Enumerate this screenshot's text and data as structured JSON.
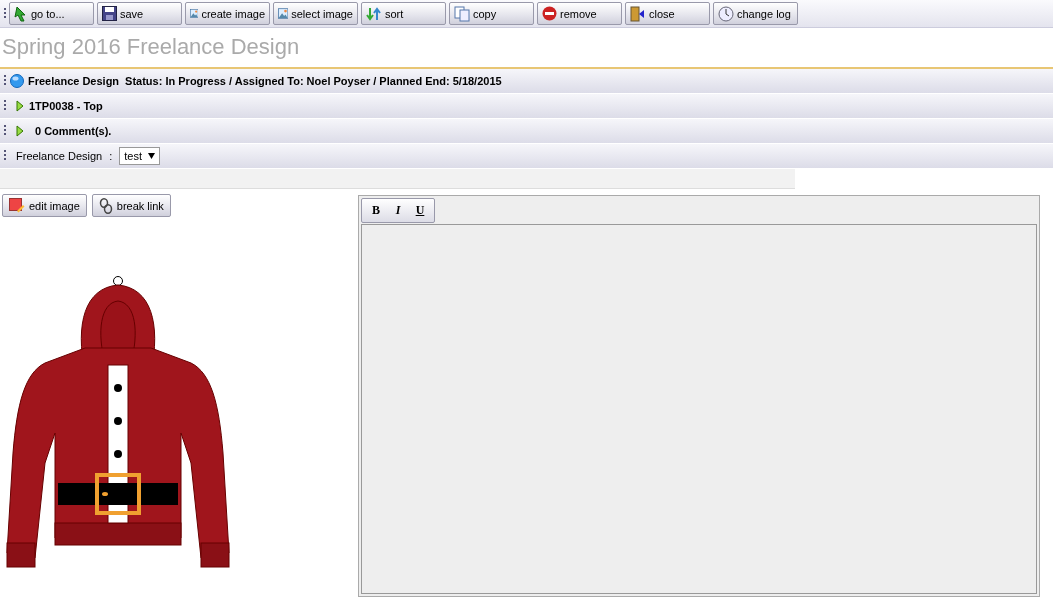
{
  "toolbar": [
    {
      "kind": "goto",
      "label": "go to..."
    },
    {
      "kind": "save",
      "label": "save"
    },
    {
      "kind": "image",
      "label": "create image"
    },
    {
      "kind": "image",
      "label": "select image"
    },
    {
      "kind": "sort",
      "label": "sort"
    },
    {
      "kind": "copy",
      "label": "copy"
    },
    {
      "kind": "remove",
      "label": "remove"
    },
    {
      "kind": "close",
      "label": "close"
    },
    {
      "kind": "log",
      "label": "change log"
    }
  ],
  "title": "Spring 2016 Freelance Design",
  "sections": [
    {
      "kind": "status",
      "label": "Freelance Design",
      "text": "Status: In Progress / Assigned To: Noel Poyser / Planned End: 5/18/2015"
    },
    {
      "kind": "collapsible",
      "text": "1TP0038 - Top",
      "expanded": false
    },
    {
      "kind": "collapsible",
      "text": "0 Comment(s).",
      "expanded": false
    }
  ],
  "field": {
    "label": "Freelance Design",
    "separator": ":",
    "value": "test"
  },
  "image_buttons": [
    {
      "kind": "edit",
      "label": "edit image"
    },
    {
      "kind": "link",
      "label": "break link"
    }
  ],
  "editor": {
    "buttons": [
      {
        "kind": "bold",
        "label": "B"
      },
      {
        "kind": "italic",
        "label": "I"
      },
      {
        "kind": "underline",
        "label": "U"
      }
    ]
  }
}
